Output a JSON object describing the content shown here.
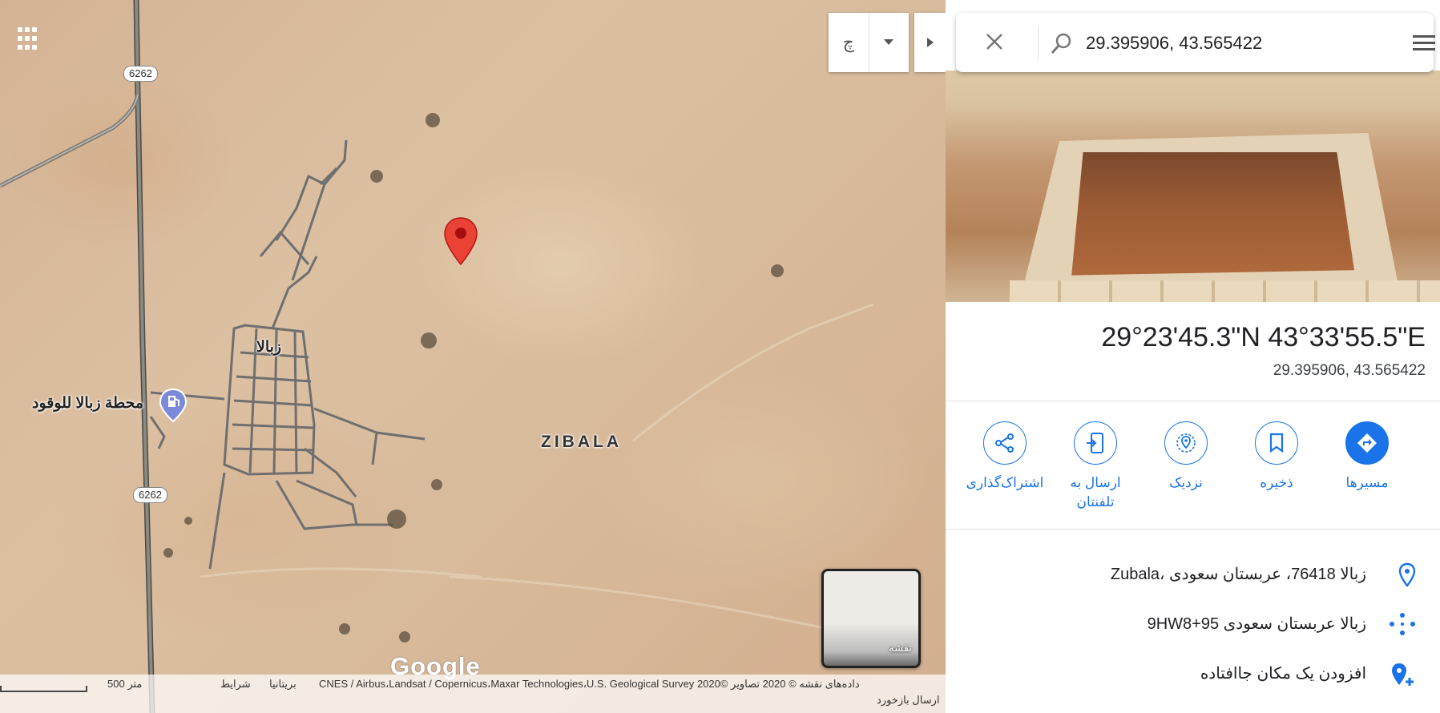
{
  "map": {
    "road_labels": [
      "6262",
      "6262"
    ],
    "place_labels": {
      "village": "زبالا",
      "fuel_station": "محطة زبالا للوقود",
      "area": "ZIBALA"
    },
    "layer_toggle_glyph": "چ",
    "minimap_label": "نقشه",
    "google_logo": "Google",
    "footer": {
      "scale": "500 متر",
      "terms": "شرایط",
      "region": "بریتانیا",
      "attribution": "داده‌های نقشه © 2020 تصاویر ©2020 CNES / Airbus،Landsat / Copernicus،Maxar Technologies،U.S. Geological Survey",
      "feedback": "ارسال بازخورد"
    },
    "pin_color": "#ea4335"
  },
  "search": {
    "value": "29.395906, 43.565422",
    "icons": [
      "close-icon",
      "search-icon",
      "menu-icon"
    ]
  },
  "place": {
    "title": "29°23'45.3\"N 43°33'55.5\"E",
    "subtitle": "29.395906, 43.565422"
  },
  "actions": [
    {
      "label": "مسیرها",
      "icon": "directions-icon"
    },
    {
      "label": "ذخیره",
      "icon": "bookmark-icon"
    },
    {
      "label": "نزدیک",
      "icon": "nearby-icon"
    },
    {
      "label": "ارسال به تلفنتان",
      "icon": "send-to-phone-icon"
    },
    {
      "label": "اشتراک‌گذاری",
      "icon": "share-icon"
    }
  ],
  "info": {
    "address": "Zubala، زبالا 76418، عربستان سعودی",
    "plus_code": "9HW8+95 زبالا عربستان سعودی",
    "add_missing": "افزودن یک مکان جاافتاده"
  },
  "accent_color": "#1a73e8"
}
